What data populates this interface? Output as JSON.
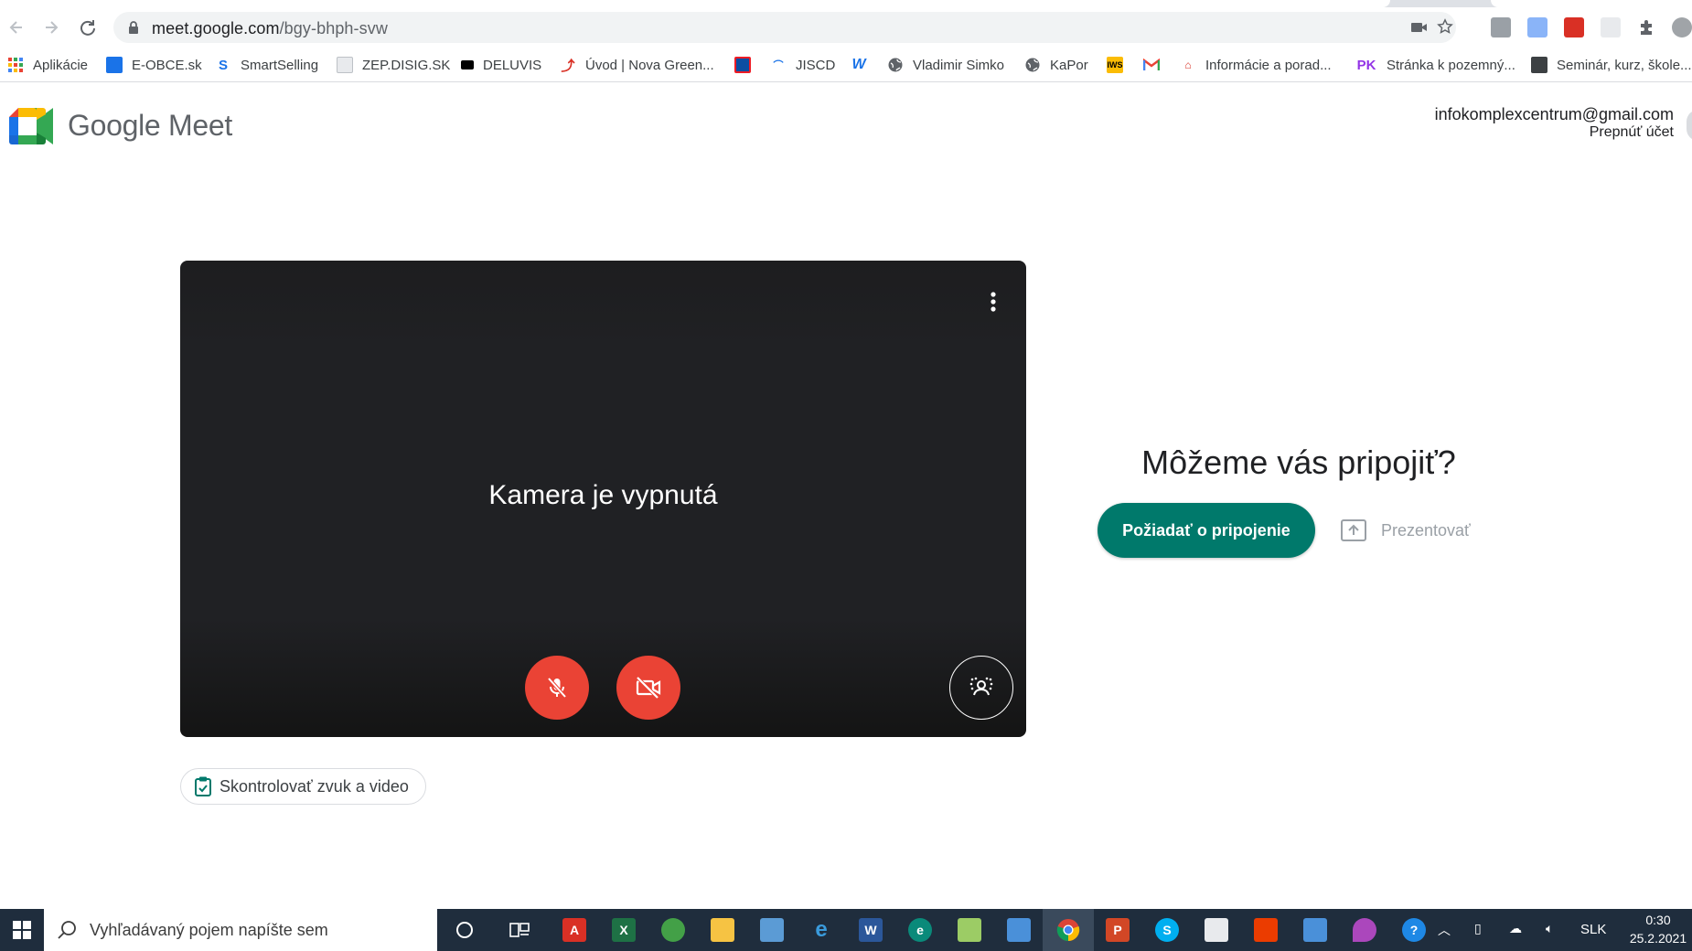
{
  "browser": {
    "url_host": "meet.google.com",
    "url_path": "/bgy-bhph-svw",
    "bookmarks": [
      {
        "label": "Aplikácie",
        "icon": "apps-grid-icon",
        "color": "#ea4335"
      },
      {
        "label": "E-OBCE.sk",
        "icon": "eobce-icon",
        "color": "#1a73e8"
      },
      {
        "label": "SmartSelling",
        "icon": "smartselling-icon",
        "color": "#1a73e8"
      },
      {
        "label": "ZEP.DISIG.SK",
        "icon": "document-icon",
        "color": "#9aa0a6"
      },
      {
        "label": "DELUVIS",
        "icon": "deluvis-icon",
        "color": "#000000"
      },
      {
        "label": "Úvod | Nova Green...",
        "icon": "novagreen-icon",
        "color": "#d93025"
      },
      {
        "label": "",
        "icon": "slovak-crest-icon",
        "color": "#0b4ea2"
      },
      {
        "label": "JISCD",
        "icon": "jiscd-icon",
        "color": "#1a73e8"
      },
      {
        "label": "",
        "icon": "w-logo-icon",
        "color": "#1a73e8"
      },
      {
        "label": "Vladimir Simko",
        "icon": "globe-icon",
        "color": "#5f6368"
      },
      {
        "label": "KaPor",
        "icon": "globe-icon",
        "color": "#5f6368"
      },
      {
        "label": "",
        "icon": "iws-icon",
        "color": "#fbbc04"
      },
      {
        "label": "",
        "icon": "gmail-icon",
        "color": "#ea4335"
      },
      {
        "label": "Informácie a porad...",
        "icon": "info-icon",
        "color": "#d93025"
      },
      {
        "label": "Stránka k pozemný...",
        "icon": "pk-icon",
        "color": "#9334e6"
      },
      {
        "label": "Seminár, kurz, škole...",
        "icon": "seminar-icon",
        "color": "#3c4043"
      }
    ]
  },
  "header": {
    "app_name": "Google Meet",
    "account_email": "infokomplexcentrum@gmail.com",
    "switch_account": "Prepnúť účet"
  },
  "preview": {
    "camera_off": "Kamera je vypnutá",
    "check_av": "Skontrolovať zvuk a video"
  },
  "join": {
    "question": "Môžeme vás pripojiť?",
    "ask_to_join": "Požiadať o pripojenie",
    "present": "Prezentovať"
  },
  "taskbar": {
    "search_placeholder": "Vyhľadávaný pojem napíšte sem",
    "language": "SLK",
    "time": "0:30",
    "date": "25.2.2021"
  },
  "colors": {
    "accent_teal": "#00796b",
    "danger_red": "#ea4335",
    "preview_bg": "#202124",
    "taskbar_bg": "#1f2d3d"
  }
}
